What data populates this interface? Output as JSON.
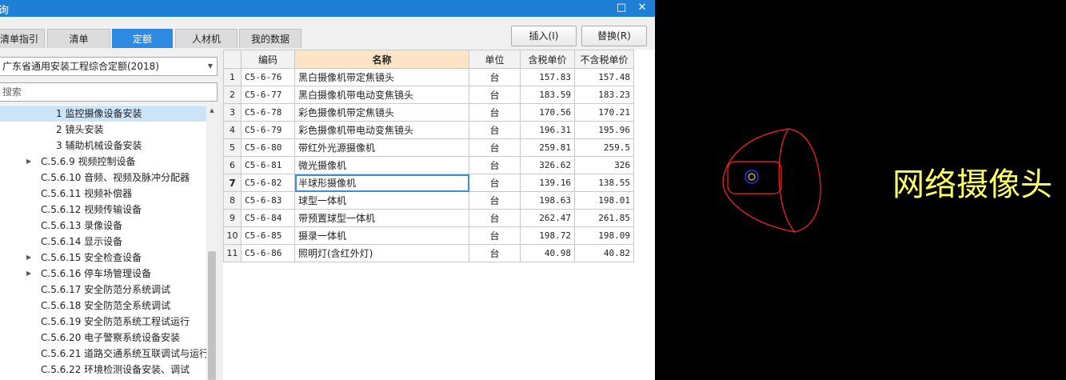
{
  "window": {
    "title": "询",
    "restore_icon": "□",
    "close_icon": "✕"
  },
  "tabs": [
    {
      "label": "清单指引",
      "active": false
    },
    {
      "label": "清单",
      "active": false
    },
    {
      "label": "定额",
      "active": true
    },
    {
      "label": "人材机",
      "active": false
    },
    {
      "label": "我的数据",
      "active": false
    }
  ],
  "actions": {
    "insert": "插入(I)",
    "replace": "替换(R)"
  },
  "library_select": {
    "value": "广东省通用安装工程综合定额(2018)"
  },
  "search": {
    "placeholder": "搜索"
  },
  "tree": [
    {
      "label": "1 监控摄像设备安装",
      "selected": true,
      "expandable": false
    },
    {
      "label": "2 镜头安装",
      "selected": false,
      "expandable": false
    },
    {
      "label": "3 辅助机械设备安装",
      "selected": false,
      "expandable": false
    },
    {
      "label": "C.5.6.9 视频控制设备",
      "selected": false,
      "expandable": true
    },
    {
      "label": "C.5.6.10 音频、视频及脉冲分配器",
      "selected": false,
      "expandable": false
    },
    {
      "label": "C.5.6.11 视频补偿器",
      "selected": false,
      "expandable": false
    },
    {
      "label": "C.5.6.12 视频传输设备",
      "selected": false,
      "expandable": false
    },
    {
      "label": "C.5.6.13 录像设备",
      "selected": false,
      "expandable": false
    },
    {
      "label": "C.5.6.14 显示设备",
      "selected": false,
      "expandable": false
    },
    {
      "label": "C.5.6.15 安全检查设备",
      "selected": false,
      "expandable": true
    },
    {
      "label": "C.5.6.16 停车场管理设备",
      "selected": false,
      "expandable": true
    },
    {
      "label": "C.5.6.17 安全防范分系统调试",
      "selected": false,
      "expandable": false
    },
    {
      "label": "C.5.6.18 安全防范全系统调试",
      "selected": false,
      "expandable": false
    },
    {
      "label": "C.5.6.19 安全防范系统工程试运行",
      "selected": false,
      "expandable": false
    },
    {
      "label": "C.5.6.20 电子警察系统设备安装",
      "selected": false,
      "expandable": false
    },
    {
      "label": "C.5.6.21 道路交通系统互联调试与运行",
      "selected": false,
      "expandable": false
    },
    {
      "label": "C.5.6.22 环境检测设备安装、调试",
      "selected": false,
      "expandable": false
    }
  ],
  "grid": {
    "columns": [
      "编码",
      "名称",
      "单位",
      "含税单价",
      "不含税单价"
    ],
    "current_row": 7,
    "rows": [
      {
        "no": "1",
        "code": "C5-6-76",
        "name": "黑白摄像机带定焦镜头",
        "unit": "台",
        "price_tax": "157.83",
        "price_notax": "157.48"
      },
      {
        "no": "2",
        "code": "C5-6-77",
        "name": "黑白摄像机带电动变焦镜头",
        "unit": "台",
        "price_tax": "183.59",
        "price_notax": "183.23"
      },
      {
        "no": "3",
        "code": "C5-6-78",
        "name": "彩色摄像机带定焦镜头",
        "unit": "台",
        "price_tax": "170.56",
        "price_notax": "170.21"
      },
      {
        "no": "4",
        "code": "C5-6-79",
        "name": "彩色摄像机带电动变焦镜头",
        "unit": "台",
        "price_tax": "196.31",
        "price_notax": "195.96"
      },
      {
        "no": "5",
        "code": "C5-6-80",
        "name": "带红外光源摄像机",
        "unit": "台",
        "price_tax": "259.81",
        "price_notax": "259.5"
      },
      {
        "no": "6",
        "code": "C5-6-81",
        "name": "微光摄像机",
        "unit": "台",
        "price_tax": "326.62",
        "price_notax": "326"
      },
      {
        "no": "7",
        "code": "C5-6-82",
        "name": "半球形摄像机",
        "unit": "台",
        "price_tax": "139.16",
        "price_notax": "138.55"
      },
      {
        "no": "8",
        "code": "C5-6-83",
        "name": "球型一体机",
        "unit": "台",
        "price_tax": "198.63",
        "price_notax": "198.01"
      },
      {
        "no": "9",
        "code": "C5-6-84",
        "name": "带预置球型一体机",
        "unit": "台",
        "price_tax": "262.47",
        "price_notax": "261.85"
      },
      {
        "no": "10",
        "code": "C5-6-85",
        "name": "摄录一体机",
        "unit": "台",
        "price_tax": "198.72",
        "price_notax": "198.09"
      },
      {
        "no": "11",
        "code": "C5-6-86",
        "name": "照明灯(含红外灯)",
        "unit": "台",
        "price_tax": "40.98",
        "price_notax": "40.82"
      }
    ]
  },
  "cad": {
    "label": "网络摄像头",
    "symbol_icon": "network-camera-symbol-icon",
    "colors": {
      "outline": "#ff2222",
      "lens_ring": "#1a3cff",
      "lens_core": "#ffcc00",
      "text": "#ffff66"
    }
  }
}
